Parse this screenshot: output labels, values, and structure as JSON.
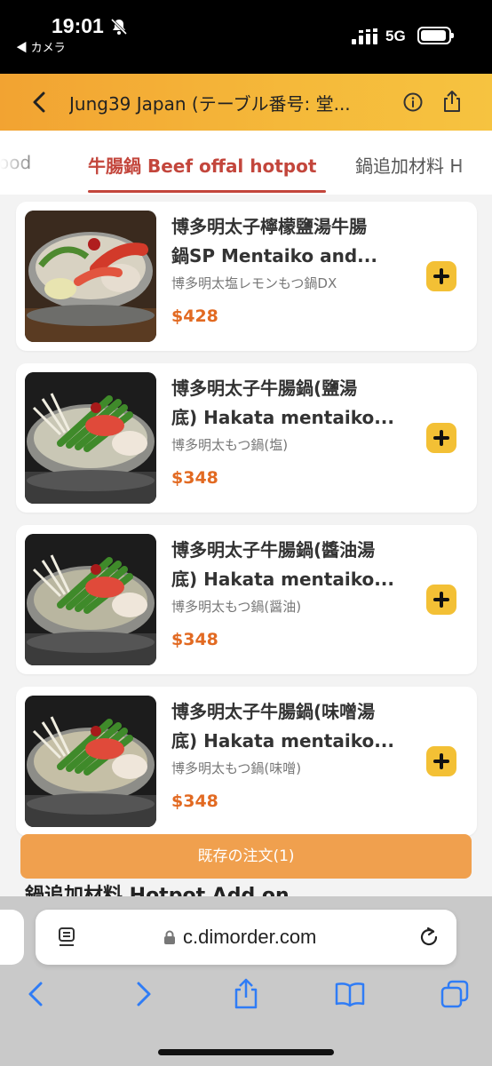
{
  "status_bar": {
    "time": "19:01",
    "back_app": "◀ カメラ",
    "network": "5G"
  },
  "header": {
    "title": "Jung39 Japan (テーブル番号: 堂..."
  },
  "tabs": {
    "previous": "ood",
    "active": "牛腸鍋 Beef offal hotpot",
    "next": "鍋追加材料 H"
  },
  "items": [
    {
      "name_line1": "博多明太子檸檬鹽湯牛腸",
      "name_line2": "鍋SP Mentaiko and...",
      "subtitle": "博多明太塩レモンもつ鍋DX",
      "price": "$428"
    },
    {
      "name_line1": "博多明太子牛腸鍋(鹽湯",
      "name_line2": "底) Hakata mentaiko...",
      "subtitle": "博多明太もつ鍋(塩)",
      "price": "$348"
    },
    {
      "name_line1": "博多明太子牛腸鍋(醬油湯",
      "name_line2": "底) Hakata mentaiko...",
      "subtitle": "博多明太もつ鍋(醤油)",
      "price": "$348"
    },
    {
      "name_line1": "博多明太子牛腸鍋(味噌湯",
      "name_line2": "底) Hakata mentaiko...",
      "subtitle": "博多明太もつ鍋(味噌)",
      "price": "$348"
    }
  ],
  "order_bar": {
    "label": "既存の注文(1)"
  },
  "next_section": {
    "title": "鍋追加材料 Hotpot Add on"
  },
  "browser": {
    "url": "c.dimorder.com"
  },
  "colors": {
    "accent": "#f5b93a",
    "active_tab": "#c3463c",
    "price": "#e26a22",
    "add_button": "#f3c035",
    "order_bar": "#f0a04e",
    "ios_blue": "#2f7cf6"
  }
}
